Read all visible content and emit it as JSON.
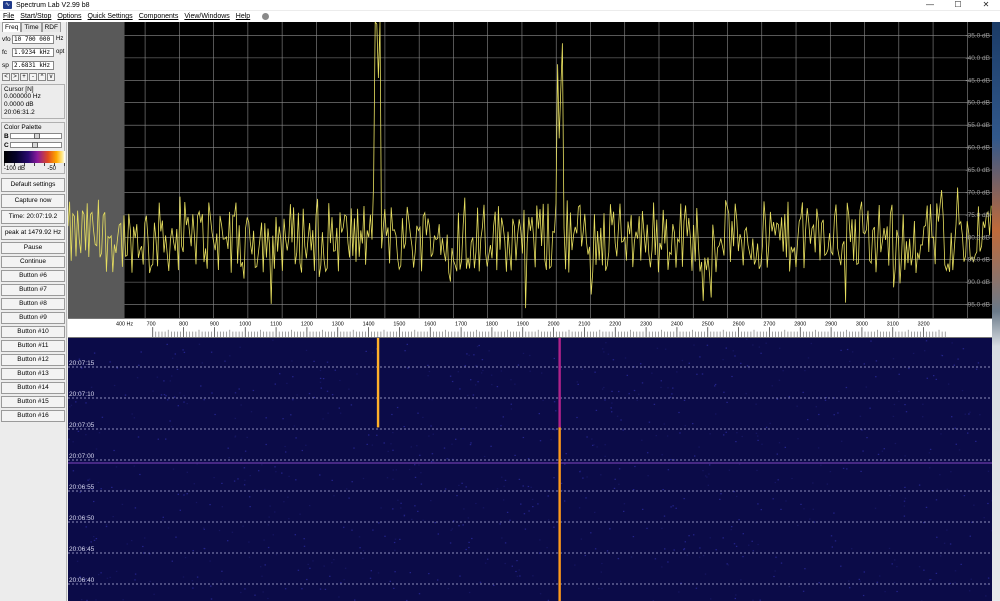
{
  "window": {
    "title": "Spectrum Lab V2.99 b8",
    "minimize_glyph": "—",
    "maximize_glyph": "☐",
    "close_glyph": "✕"
  },
  "menu": [
    "File",
    "Start/Stop",
    "Options",
    "Quick Settings",
    "Components",
    "View/Windows",
    "Help"
  ],
  "left_panel": {
    "tabs": [
      "Freq",
      "Time",
      "RDF"
    ],
    "params": [
      {
        "label": "vfo",
        "value": "10 700 000",
        "unit": "Hz"
      },
      {
        "label": "fc",
        "value": "1.9234  kHz",
        "unit": "opt"
      },
      {
        "label": "sp",
        "value": "2.6831  kHz",
        "unit": ""
      }
    ],
    "nav_buttons": [
      "<",
      ">",
      "+",
      "-",
      "^",
      "v"
    ],
    "cursor": {
      "title": "Cursor [N]",
      "freq": "0.000000 Hz",
      "level": "0.0000 dB",
      "time": "20:06:31.2"
    },
    "palette": {
      "title": "Color Palette",
      "b_label": "B",
      "c_label": "C",
      "b_position": 0.5,
      "c_position": 0.45,
      "min_label": "-100 dB",
      "max_label": "-50"
    },
    "buttons": [
      "Default settings",
      "Capture now",
      "Time:  20:07:19.2",
      "peak at 1479.92 Hz",
      "Pause",
      "Continue",
      "Button #6",
      "Button #7",
      "Button #8",
      "Button #9",
      "Button #10",
      "Button #11",
      "Button #12",
      "Button #13",
      "Button #14",
      "Button #15",
      "Button #16"
    ]
  },
  "spectrum": {
    "db_labels": [
      "-35.0 dB",
      "-40.0 dB",
      "-45.0 dB",
      "-50.0 dB",
      "-55.0 dB",
      "-60.0 dB",
      "-65.0 dB",
      "-70.0 dB",
      "-75.0 dB",
      "-80.0 dB",
      "-85.0 dB",
      "-90.0 dB",
      "-95.0 dB"
    ],
    "db_values": [
      -35,
      -40,
      -45,
      -50,
      -55,
      -60,
      -65,
      -70,
      -75,
      -80,
      -85,
      -90,
      -95
    ],
    "db_range": [
      -98,
      -32
    ],
    "freq_range": [
      575,
      3272
    ],
    "passband_start_hz": 740,
    "peaks": [
      {
        "freq_hz": 1480,
        "level_db": -46.5
      },
      {
        "freq_hz": 2010,
        "level_db": -60.5
      }
    ],
    "noise_floor_db": -80,
    "trace_color": "#e8e060",
    "grid_color": "#8c8c8c",
    "background": "#000000",
    "shaded_color": "#595959"
  },
  "freq_axis": {
    "unit_label": "400 Hz",
    "first_label": "700",
    "labels": [
      "800",
      "900",
      "1000",
      "1100",
      "1200",
      "1300",
      "1400",
      "1500",
      "1600",
      "1700",
      "1800",
      "1900",
      "2000",
      "2100",
      "2200",
      "2300",
      "2400",
      "2500",
      "2600",
      "2700",
      "2800",
      "2900",
      "3000",
      "3100",
      "3200"
    ],
    "label_values": [
      800,
      900,
      1000,
      1100,
      1200,
      1300,
      1400,
      1500,
      1600,
      1700,
      1800,
      1900,
      2000,
      2100,
      2200,
      2300,
      2400,
      2500,
      2600,
      2700,
      2800,
      2900,
      3000,
      3100,
      3200
    ]
  },
  "waterfall": {
    "time_labels": [
      "20:07:15",
      "20:07:10",
      "20:07:05",
      "20:07:00",
      "20:06:55",
      "20:06:50",
      "20:06:45",
      "20:06:40"
    ],
    "background": "#0b0b48",
    "line_color": "#b8b8e0",
    "traces": [
      {
        "freq_hz": 1480,
        "from_fraction": 0.0,
        "to_fraction": 0.34,
        "color": "#ffb02a"
      },
      {
        "freq_hz": 2010,
        "from_fraction": 0.0,
        "to_fraction": 0.34,
        "color": "#b0228a"
      },
      {
        "freq_hz": 2010,
        "from_fraction": 0.34,
        "to_fraction": 1.0,
        "color": "#ff9a1a"
      }
    ]
  }
}
